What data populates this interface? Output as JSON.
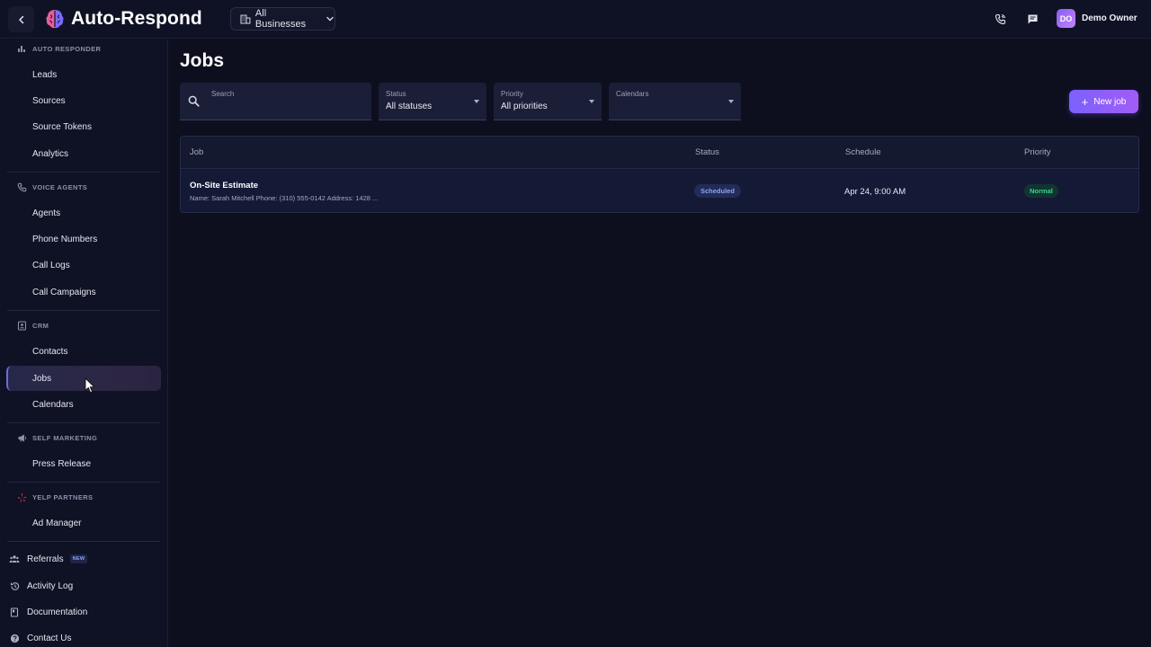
{
  "header": {
    "app_title": "Auto-Respond",
    "business_selector": "All Businesses",
    "user": {
      "initials": "DO",
      "name": "Demo Owner"
    },
    "icons": [
      "back-chevron-icon",
      "brain-logo-icon",
      "building-icon",
      "chevron-down-icon",
      "phone-icon",
      "chat-icon"
    ]
  },
  "sidebar": {
    "sections": [
      {
        "title": "AUTO RESPONDER",
        "icon": "bar-chart-icon",
        "items": [
          "Leads",
          "Sources",
          "Source Tokens",
          "Analytics"
        ]
      },
      {
        "title": "VOICE AGENTS",
        "icon": "phone-icon",
        "items": [
          "Agents",
          "Phone Numbers",
          "Call Logs",
          "Call Campaigns"
        ]
      },
      {
        "title": "CRM",
        "icon": "contacts-icon",
        "items": [
          "Contacts",
          "Jobs",
          "Calendars"
        ]
      },
      {
        "title": "SELF MARKETING",
        "icon": "megaphone-icon",
        "items": [
          "Press Release"
        ]
      },
      {
        "title": "YELP PARTNERS",
        "icon": "yelp-icon",
        "items": [
          "Ad Manager"
        ]
      }
    ],
    "active_item": "Jobs",
    "bottom": [
      {
        "label": "Referrals",
        "badge": "NEW",
        "icon": "people-icon"
      },
      {
        "label": "Activity Log",
        "icon": "history-icon"
      },
      {
        "label": "Documentation",
        "icon": "book-icon"
      },
      {
        "label": "Contact Us",
        "icon": "help-icon"
      }
    ]
  },
  "main": {
    "title": "Jobs",
    "filters": {
      "search": {
        "label": "Search",
        "value": ""
      },
      "status": {
        "label": "Status",
        "value": "All statuses"
      },
      "priority": {
        "label": "Priority",
        "value": "All priorities"
      },
      "calendars": {
        "label": "Calendars",
        "value": ""
      }
    },
    "new_job_button": "New job",
    "table": {
      "columns": [
        "Job",
        "Status",
        "Schedule",
        "Priority"
      ],
      "rows": [
        {
          "title": "On-Site Estimate",
          "description": "Name: Sarah Mitchell Phone: (310) 555-0142 Address: 1428 ...",
          "status": "Scheduled",
          "schedule": "Apr 24, 9:00 AM",
          "priority": "Normal"
        }
      ]
    }
  },
  "colors": {
    "background": "#0d0f1f",
    "accent": "#7b61ff",
    "status_scheduled": "#8fa3ff",
    "priority_normal": "#34d39a",
    "yelp": "#e0344a"
  }
}
